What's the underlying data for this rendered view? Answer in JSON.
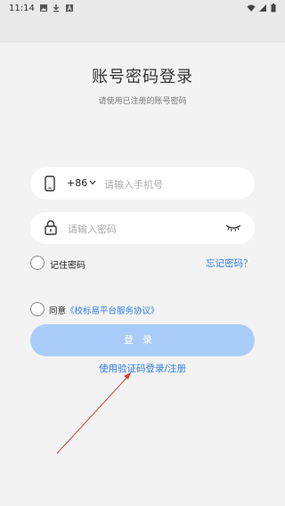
{
  "status_bar": {
    "time": "11:14",
    "left_icons": [
      "image-icon",
      "download-icon",
      "a-box-icon"
    ],
    "right_icons": [
      "wifi-icon",
      "signal-icon",
      "battery-icon"
    ]
  },
  "header": {
    "title": "账号密码登录",
    "subtitle": "请使用已注册的账号密码"
  },
  "phone_field": {
    "country_code": "+86",
    "placeholder": "请输入手机号"
  },
  "password_field": {
    "placeholder": "请输入密码"
  },
  "remember": {
    "label": "记住密码",
    "checked": false
  },
  "forgot_label": "忘记密码？",
  "agreement": {
    "prefix": "同意",
    "link": "《校标易平台服务协议》",
    "checked": false
  },
  "login_button": "登录",
  "sms_login_link": "使用验证码登录/注册",
  "colors": {
    "accent": "#2f7ee6",
    "button_disabled": "#a9cdf8",
    "background": "#f3f3f3",
    "annotation_arrow": "#d9413a"
  }
}
